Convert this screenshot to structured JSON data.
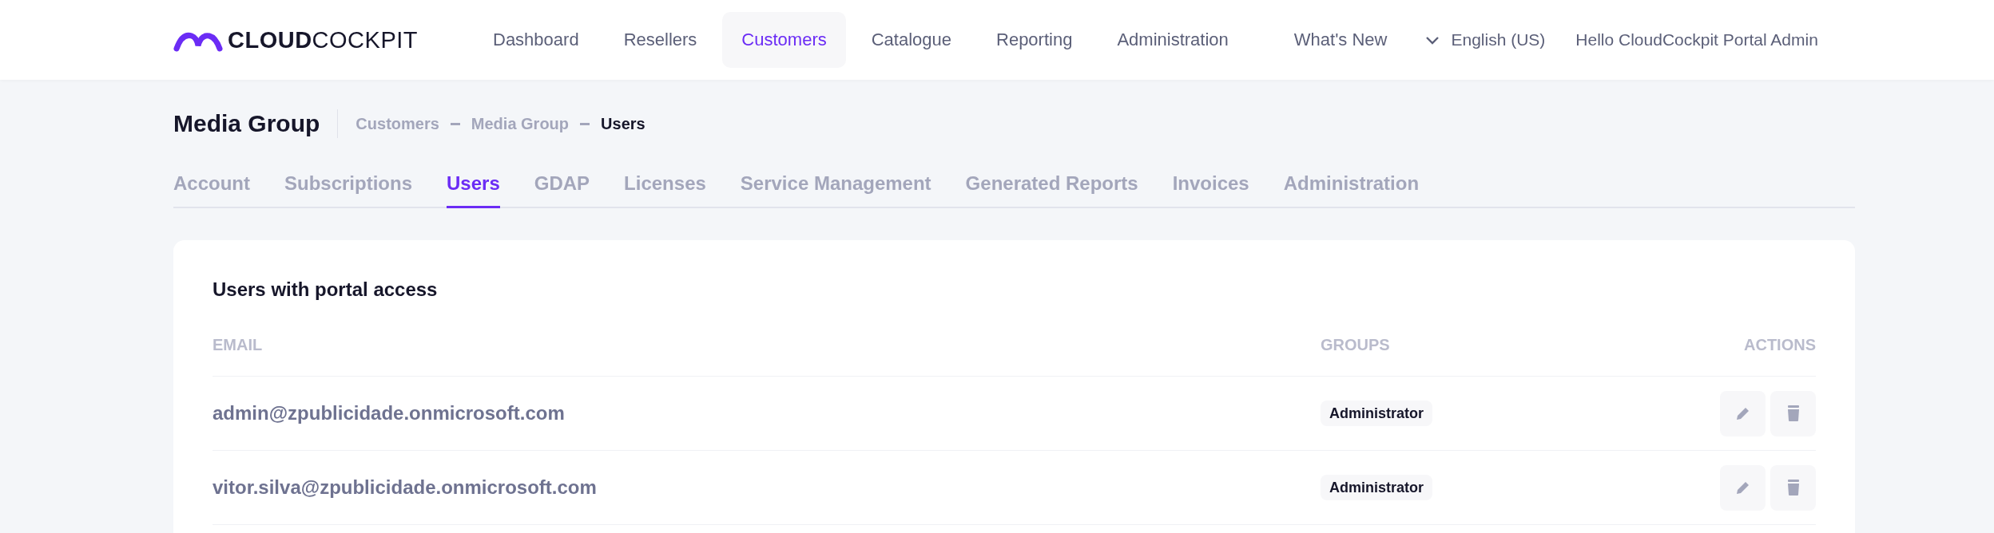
{
  "header": {
    "logo": "**CLOUD**COCKPIT",
    "nav": [
      {
        "label": "Dashboard",
        "selected": false
      },
      {
        "label": "Resellers",
        "selected": false
      },
      {
        "label": "Customers",
        "selected": true
      },
      {
        "label": "Catalogue",
        "selected": false
      },
      {
        "label": "Reporting",
        "selected": false
      },
      {
        "label": "Administration",
        "selected": false
      }
    ],
    "whats_new": "What's New",
    "language": "English (US)",
    "greeting": "Hello CloudCockpit Portal Admin"
  },
  "page": {
    "title": "Media Group",
    "breadcrumb": [
      {
        "label": "Customers",
        "current": false
      },
      {
        "label": "Media Group",
        "current": false
      },
      {
        "label": "Users",
        "current": true
      }
    ]
  },
  "tabs": [
    {
      "label": "Account",
      "selected": false
    },
    {
      "label": "Subscriptions",
      "selected": false
    },
    {
      "label": "Users",
      "selected": true
    },
    {
      "label": "GDAP",
      "selected": false
    },
    {
      "label": "Licenses",
      "selected": false
    },
    {
      "label": "Service Management",
      "selected": false
    },
    {
      "label": "Generated Reports",
      "selected": false
    },
    {
      "label": "Invoices",
      "selected": false
    },
    {
      "label": "Administration",
      "selected": false
    }
  ],
  "card": {
    "title": "Users with portal access",
    "columns": [
      "EMAIL",
      "GROUPS",
      "ACTIONS"
    ],
    "rows": [
      {
        "email": "admin@zpublicidade.onmicrosoft.com",
        "groups": [
          "Administrator"
        ]
      },
      {
        "email": "vitor.silva@zpublicidade.onmicrosoft.com",
        "groups": [
          "Administrator"
        ]
      }
    ]
  }
}
